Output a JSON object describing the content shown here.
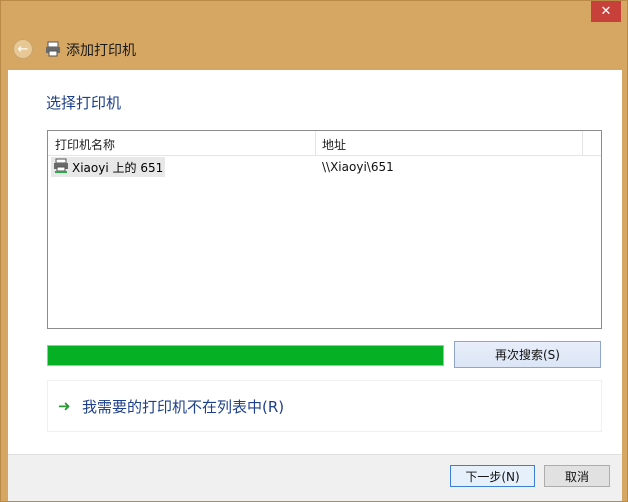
{
  "window": {
    "title": "添加打印机",
    "close_glyph": "✕"
  },
  "heading": "选择打印机",
  "list": {
    "columns": [
      "打印机名称",
      "地址"
    ],
    "rows": [
      {
        "name": "Xiaoyi 上的 651",
        "address": "\\\\Xiaoyi\\651"
      }
    ]
  },
  "progress": {
    "value": 1.0,
    "color": "#06b025"
  },
  "buttons": {
    "search_again": "再次搜索(S)",
    "next": "下一步(N)",
    "cancel": "取消"
  },
  "link": {
    "text": "我需要的打印机不在列表中(R)",
    "icon": "arrow-right-icon"
  },
  "icons": {
    "back": "back-arrow-icon",
    "printer": "printer-icon"
  },
  "colors": {
    "accent_text": "#1e3f8a",
    "frame": "#d6a763",
    "close": "#c7403a"
  }
}
